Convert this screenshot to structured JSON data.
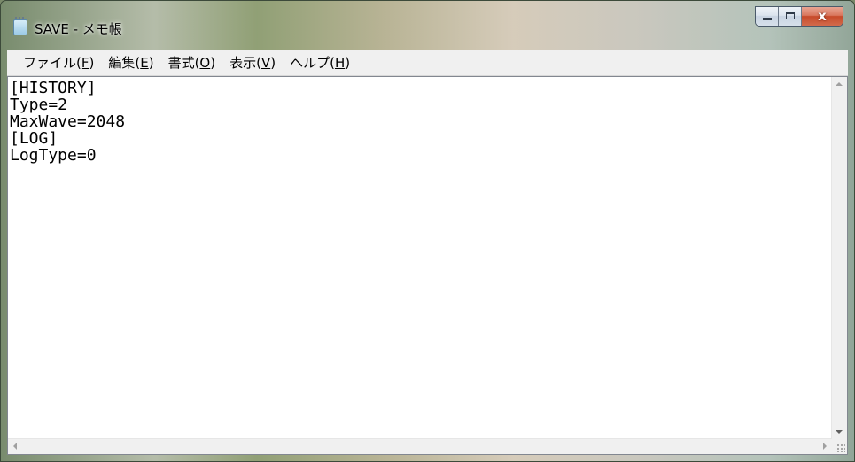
{
  "window": {
    "title": "SAVE - メモ帳",
    "app_icon": "notepad-icon"
  },
  "caption_buttons": {
    "minimize_icon": "minimize-icon",
    "maximize_icon": "maximize-icon",
    "close_glyph": "x"
  },
  "menu": {
    "items": [
      {
        "label": "ファイル(",
        "mnemonic": "F",
        "suffix": ")"
      },
      {
        "label": "編集(",
        "mnemonic": "E",
        "suffix": ")"
      },
      {
        "label": "書式(",
        "mnemonic": "O",
        "suffix": ")"
      },
      {
        "label": "表示(",
        "mnemonic": "V",
        "suffix": ")"
      },
      {
        "label": "ヘルプ(",
        "mnemonic": "H",
        "suffix": ")"
      }
    ]
  },
  "document": {
    "text": "[HISTORY]\nType=2\nMaxWave=2048\n[LOG]\nLogType=0"
  },
  "colors": {
    "close_button": "#c74a2a",
    "menu_background": "#f0f0f0",
    "editor_background": "#ffffff"
  }
}
